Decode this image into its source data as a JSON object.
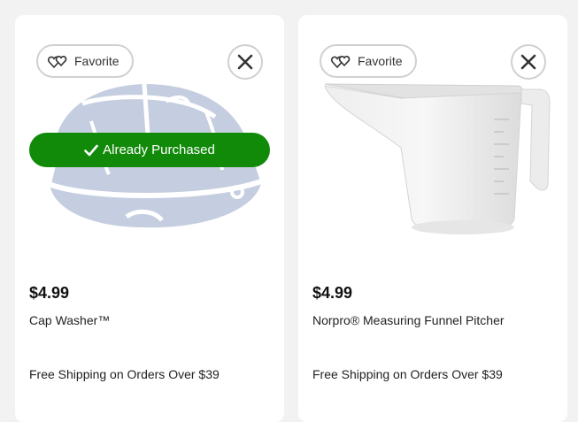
{
  "products": [
    {
      "favorite_label": "Favorite",
      "favorite_icon": "two-hearts-icon",
      "close_icon": "close-icon",
      "badge_label": "Already Purchased",
      "badge_icon": "checkmark-icon",
      "badge_color": "#118a0a",
      "price": "$4.99",
      "title": "Cap Washer™",
      "shipping": "Free Shipping on Orders Over $39"
    },
    {
      "favorite_label": "Favorite",
      "favorite_icon": "two-hearts-icon",
      "close_icon": "close-icon",
      "price": "$4.99",
      "title": "Norpro® Measuring Funnel Pitcher",
      "shipping": "Free Shipping on Orders Over $39"
    }
  ]
}
